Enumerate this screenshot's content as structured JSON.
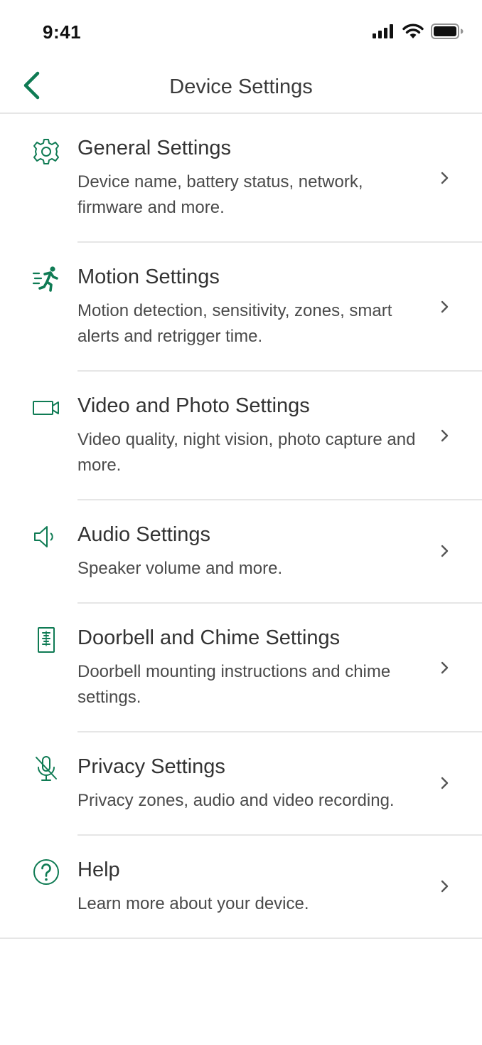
{
  "status_bar": {
    "time": "9:41"
  },
  "nav": {
    "title": "Device Settings",
    "back_icon": "chevron-left-icon"
  },
  "colors": {
    "accent": "#0f7b54",
    "divider": "#e6e6e6",
    "text": "#333333"
  },
  "settings": [
    {
      "icon": "gear-icon",
      "title": "General Settings",
      "description": "Device name, battery status, network, firmware and more."
    },
    {
      "icon": "running-person-icon",
      "title": "Motion Settings",
      "description": "Motion detection, sensitivity, zones, smart alerts and retrigger time."
    },
    {
      "icon": "video-camera-icon",
      "title": "Video and Photo Settings",
      "description": "Video quality, night vision, photo capture and more."
    },
    {
      "icon": "speaker-icon",
      "title": "Audio Settings",
      "description": "Speaker volume and more."
    },
    {
      "icon": "doorbell-icon",
      "title": "Doorbell and Chime Settings",
      "description": "Doorbell mounting instructions and chime settings."
    },
    {
      "icon": "microphone-off-icon",
      "title": "Privacy Settings",
      "description": "Privacy zones, audio and video recording."
    },
    {
      "icon": "help-circle-icon",
      "title": "Help",
      "description": "Learn more about your device."
    }
  ]
}
